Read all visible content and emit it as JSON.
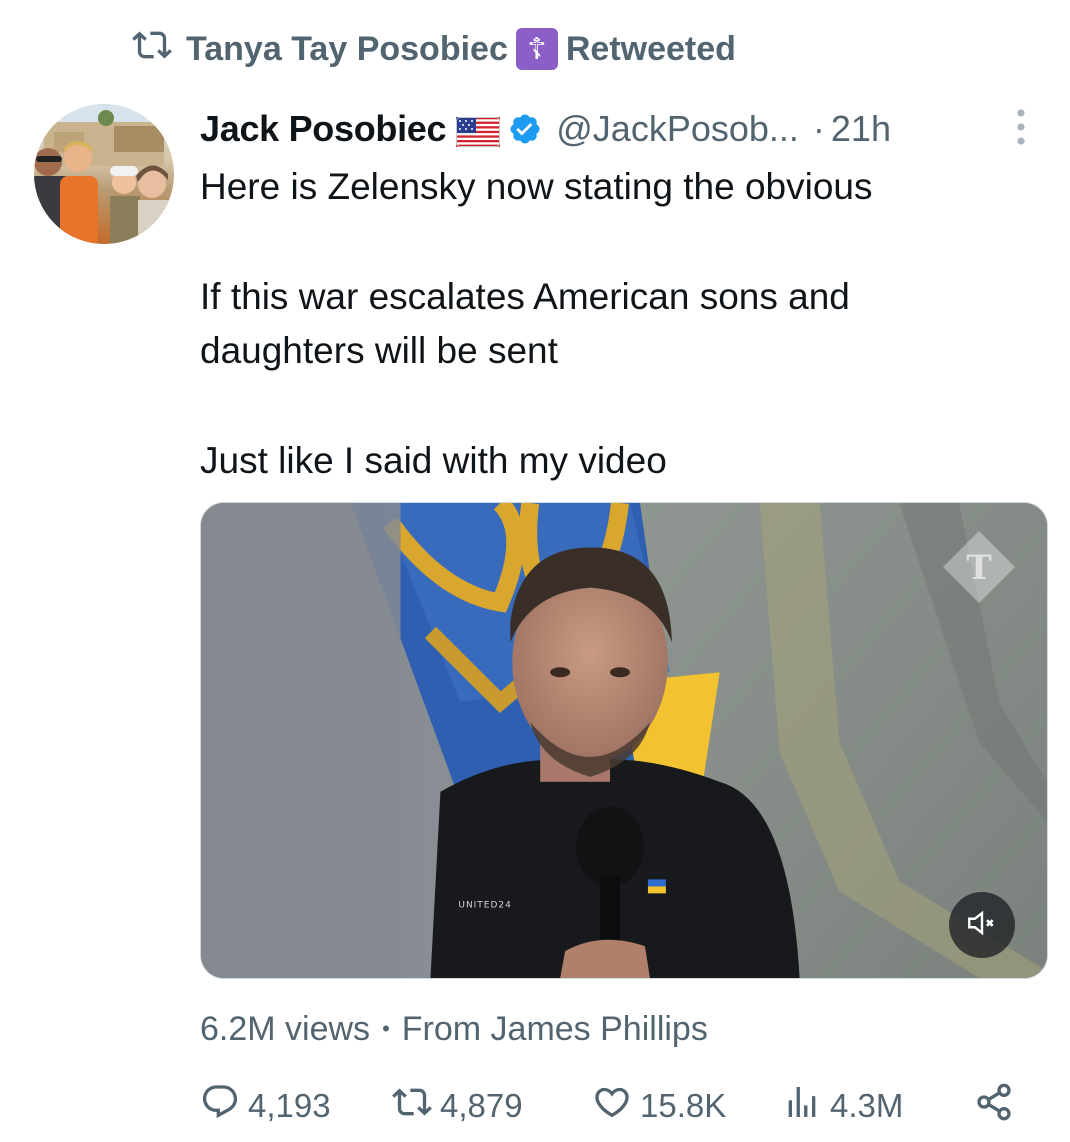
{
  "retweet": {
    "icon": "retweet-icon",
    "retweeter_name": "Tanya Tay Posobiec",
    "badge_glyph": "☦",
    "label": "Retweeted"
  },
  "tweet": {
    "author_name": "Jack Posobiec",
    "flag_icon": "us-flag-icon",
    "verified_icon": "verified-badge-icon",
    "handle": "@JackPosob...",
    "separator": "·",
    "timestamp": "21h",
    "text_lines": [
      "Here is Zelensky now stating the obvious",
      "If this war escalates American sons and daughters will be sent",
      "Just like I said with my video"
    ]
  },
  "media": {
    "type": "video",
    "source_logo": "telegraph-logo-icon",
    "mute_icon": "volume-muted-icon",
    "shirt_text": "UNITED24"
  },
  "meta": {
    "views": "6.2M views",
    "dot": "•",
    "from": "From James Phillips"
  },
  "actions": {
    "replies": "4,193",
    "retweets": "4,879",
    "likes": "15.8K",
    "views": "4.3M"
  },
  "colors": {
    "secondary_text": "#536471",
    "primary_text": "#0f1419",
    "verified_blue": "#1d9bf0",
    "badge_purple": "#8b5fc7"
  }
}
